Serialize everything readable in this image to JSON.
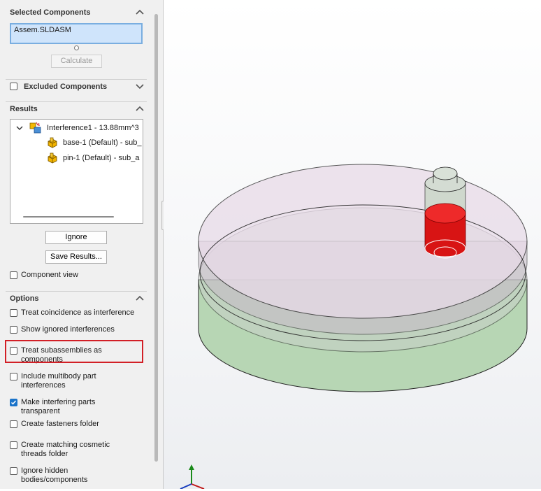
{
  "selected_components": {
    "header": "Selected Components",
    "value": "Assem.SLDASM",
    "calculate_label": "Calculate"
  },
  "excluded_components": {
    "header": "Excluded Components"
  },
  "results": {
    "header": "Results",
    "items": [
      {
        "label": "Interference1 - 13.88mm^3"
      },
      {
        "label": "base-1 (Default) - sub_"
      },
      {
        "label": "pin-1 (Default) - sub_a"
      }
    ],
    "ignore_label": "Ignore",
    "save_results_label": "Save Results...",
    "component_view_label": "Component view"
  },
  "options": {
    "header": "Options",
    "items": [
      {
        "label": "Treat coincidence as interference",
        "checked": false
      },
      {
        "label": "Show ignored interferences",
        "checked": false
      },
      {
        "label": "Treat subassemblies as components",
        "checked": false
      },
      {
        "label": "Include multibody part interferences",
        "checked": false
      },
      {
        "label": "Make interfering parts transparent",
        "checked": true
      },
      {
        "label": "Create fasteners folder",
        "checked": false
      },
      {
        "label": "Create matching cosmetic threads folder",
        "checked": false
      },
      {
        "label": "Ignore hidden bodies/components",
        "checked": false
      }
    ]
  },
  "colors": {
    "interference": "#e01010",
    "highlight": "#d21f26",
    "checkbox_checked": "#1a73c9"
  }
}
